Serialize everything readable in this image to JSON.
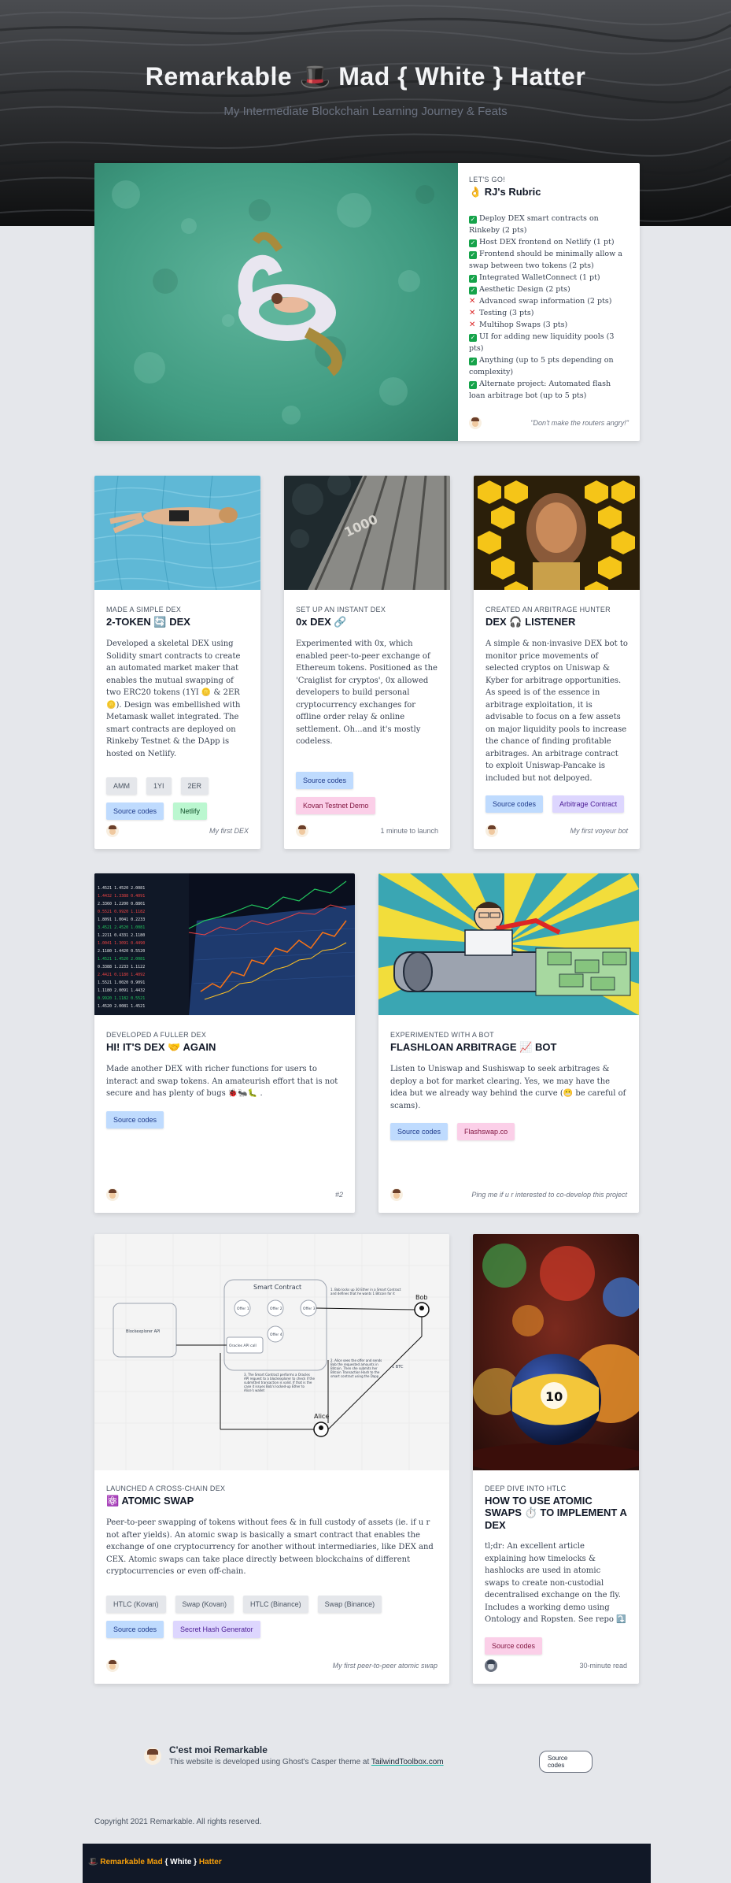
{
  "hero": {
    "title": "Remarkable 🎩 Mad { White } Hatter",
    "subtitle": "My Intermediate Blockchain Learning Journey & Feats"
  },
  "rubric": {
    "kicker": "LET's GO!",
    "title": "👌 RJ's Rubric",
    "items": [
      {
        "status": "check",
        "text": "Deploy DEX smart contracts on Rinkeby (2 pts)"
      },
      {
        "status": "check",
        "text": "Host DEX frontend on Netlify (1 pt)"
      },
      {
        "status": "check",
        "text": "Frontend should be minimally allow a swap between two tokens (2 pts)"
      },
      {
        "status": "check",
        "text": "Integrated WalletConnect (1 pt)"
      },
      {
        "status": "check",
        "text": "Aesthetic Design (2 pts)"
      },
      {
        "status": "cross",
        "text": "Advanced swap information (2 pts)"
      },
      {
        "status": "cross",
        "text": "Testing (3 pts)"
      },
      {
        "status": "cross",
        "text": "Multihop Swaps (3 pts)"
      },
      {
        "status": "check",
        "text": "UI for adding new liquidity pools (3 pts)"
      },
      {
        "status": "check",
        "text": "Anything (up to 5 pts depending on complexity)"
      },
      {
        "status": "check",
        "text": "Alternate project: Automated flash loan arbitrage bot (up to 5 pts)"
      }
    ],
    "footer_note": "\"Don't make the routers angry!\""
  },
  "cards": {
    "dex2": {
      "kicker": "MADE A SIMPLE DEX",
      "title": "2-TOKEN 🔄 DEX",
      "desc": "Developed a skeletal DEX using Solidity smart contracts to create an automated market maker that enables the mutual swapping of two ERC20 tokens (1YI 🪙 & 2ER 🪙). Design was embellished with Metamask wallet integrated. The smart contracts are deployed on Rinkeby Testnet & the DApp is hosted on Netlify.",
      "tags": [
        "AMM",
        "1YI",
        "2ER"
      ],
      "links": [
        "Source codes",
        "Netlify"
      ],
      "footer_note": "My first DEX"
    },
    "ox": {
      "kicker": "SET UP AN INSTANT DEX",
      "title": "0x DEX 🔗",
      "desc": "Experimented with 0x, which enabled peer-to-peer exchange of Ethereum tokens. Positioned as the 'Craiglist for cryptos', 0x allowed developers to build personal cryptocurrency exchanges for offline order relay & online settlement. Oh...and it's mostly codeless.",
      "links": [
        "Source codes",
        "Kovan Testnet Demo"
      ],
      "footer_note": "1 minute to launch"
    },
    "listener": {
      "kicker": "CREATED AN ARBITRAGE HUNTER",
      "title": "DEX 🎧 LISTENER",
      "desc": "A simple & non-invasive DEX bot to monitor price movements of selected cryptos on Uniswap & Kyber for arbitrage opportunities. As speed is of the essence in arbitrage exploitation, it is advisable to focus on a few assets on major liquidity pools to increase the chance of finding profitable arbitrages. An arbitrage contract to exploit Uniswap-Pancake is included but not delpoyed.",
      "links": [
        "Source codes",
        "Arbitrage Contract"
      ],
      "footer_note": "My first voyeur bot"
    },
    "again": {
      "kicker": "DEVELOPED A FULLER DEX",
      "title": "HI! IT'S DEX 🤝 AGAIN",
      "desc": "Made another DEX with richer functions for users to interact and swap tokens. An amateurish effort that is not secure and has plenty of bugs 🐞🐜🐛 .",
      "links": [
        "Source codes"
      ],
      "footer_note": "#2"
    },
    "flash": {
      "kicker": "EXPERIMENTED WITH A BOT",
      "title": "FLASHLOAN ARBITRAGE 📈 BOT",
      "desc": "Listen to Uniswap and Sushiswap to seek arbitrages & deploy a bot for market clearing. Yes, we may have the idea but we already way behind the curve (😬 be careful of scams).",
      "links": [
        "Source codes",
        "Flashswap.co"
      ],
      "footer_note": "Ping me if u r interested to co-develop this project"
    },
    "atomic": {
      "kicker": "LAUNCHED A CROSS-CHAIN DEX",
      "title": "⚛️ ATOMIC SWAP",
      "desc": "Peer-to-peer swapping of tokens without fees & in full custody of assets (ie. if u r not after yields). An atomic swap is basically a smart contract that enables the exchange of one cryptocurrency for another without intermediaries, like DEX and CEX. Atomic swaps can take place directly between blockchains of different cryptocurrencies or even off-chain.",
      "tags": [
        "HTLC (Kovan)",
        "Swap (Kovan)",
        "HTLC (Binance)",
        "Swap (Binance)"
      ],
      "links": [
        "Source codes",
        "Secret Hash Generator"
      ],
      "footer_note": "My first peer-to-peer atomic swap"
    },
    "htlc": {
      "kicker": "DEEP DIVE INTO HTLC",
      "title": "HOW TO USE ATOMIC SWAPS ⏱️ TO IMPLEMENT A DEX",
      "desc": "tl;dr: An excellent article explaining how timelocks & hashlocks are used in atomic swaps to create non-custodial decentralised exchange on the fly. Includes a working demo using Ontology and Ropsten. See repo ⤵️",
      "links": [
        "Source codes"
      ],
      "footer_note": "30-minute read"
    }
  },
  "diagram": {
    "title": "Smart Contract",
    "bob": "Bob",
    "alice": "Alice",
    "left_box": "Blockexplorer API",
    "oracle": "Oracles API call",
    "offers": [
      "Offer 1",
      "Offer 2",
      "Offer 3",
      "Offer 4"
    ],
    "note1": "1. Bob locks up 30 Ether in a Smart Contract and defines that he wants 1 Bitcoin for it",
    "note2": "2. Alice sees the offer and sends Bob the requested amounts in Bitcoin. Then she submits her Bitcoin Transaction Hash to the smart contract using the Dapp",
    "note3": "3. The Smart Contract performs a Oracles API request to a blockexplorer to check if the submitted transaction is valid. If that is the case it issues Bob's locked-up Ether to Alice's wallet",
    "btc": "1 BTC"
  },
  "author": {
    "name": "C'est moi Remarkable",
    "desc_prefix": "This website is developed using Ghost's Casper theme at ",
    "desc_link": "TailwindToolbox.com",
    "button": "Source codes"
  },
  "copyright": "Copyright 2021 Remarkable. All rights reserved.",
  "footer": {
    "brand_a": "🎩 Remarkable Mad ",
    "brand_b": "{ White }",
    "brand_c": " Hatter"
  }
}
